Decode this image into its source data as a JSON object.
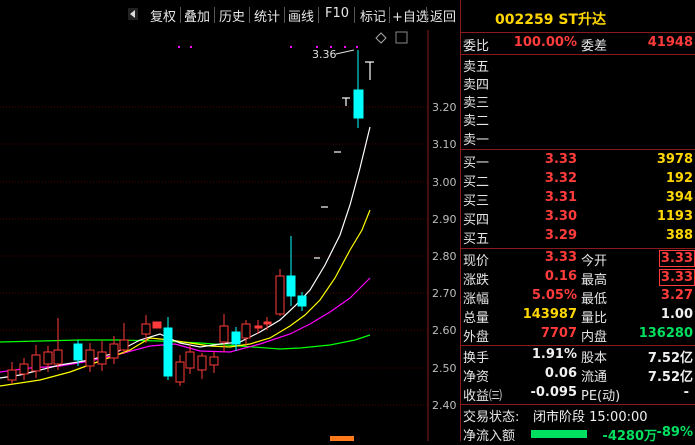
{
  "toolbar": {
    "buttons": [
      "复权",
      "叠加",
      "历史",
      "统计",
      "画线",
      "F10",
      "标记",
      "+自选",
      "返回"
    ]
  },
  "chart": {
    "high_annotation": "3.36",
    "price_ticks": [
      "3.20",
      "3.10",
      "3.00",
      "2.90",
      "2.80",
      "2.70",
      "2.60",
      "2.50",
      "2.40"
    ]
  },
  "quote": {
    "code_name": "002259 ST升达",
    "weibi_label": "委比",
    "weibi_value": "100.00%",
    "weicha_label": "委差",
    "weicha_value": "41948",
    "sell_labels": [
      "卖五",
      "卖四",
      "卖三",
      "卖二",
      "卖一"
    ],
    "buy": [
      {
        "label": "买一",
        "price": "3.33",
        "vol": "3978"
      },
      {
        "label": "买二",
        "price": "3.32",
        "vol": "192"
      },
      {
        "label": "买三",
        "price": "3.31",
        "vol": "394"
      },
      {
        "label": "买四",
        "price": "3.30",
        "vol": "1193"
      },
      {
        "label": "买五",
        "price": "3.29",
        "vol": "388"
      }
    ],
    "xianjia_label": "现价",
    "xianjia": "3.33",
    "jinkai_label": "今开",
    "jinkai": "3.33",
    "zhangdie_label": "涨跌",
    "zhangdie": "0.16",
    "zuigao_label": "最高",
    "zuigao": "3.33",
    "zhangfu_label": "涨幅",
    "zhangfu": "5.05%",
    "zuidi_label": "最低",
    "zuidi": "3.27",
    "zongliang_label": "总量",
    "zongliang": "143987",
    "liangbi_label": "量比",
    "liangbi": "1.00",
    "waipan_label": "外盘",
    "waipan": "7707",
    "neipan_label": "内盘",
    "neipan": "136280",
    "huanshou_label": "换手",
    "huanshou": "1.91%",
    "guben_label": "股本",
    "guben": "7.52亿",
    "jingzi_label": "净资",
    "jingzi": "0.06",
    "liutong_label": "流通",
    "liutong": "7.52亿",
    "shouyi_label": "收益㈢",
    "shouyi": "-0.095",
    "pe_label": "PE(动)",
    "pe": "-",
    "status_label": "交易状态:",
    "status": "闭市阶段 15:00:00",
    "netflow_label": "净流入额",
    "netflow": "-4280万",
    "netflow_pct": "-89%"
  },
  "colors": {
    "up": "#ff3b3b",
    "down": "#00ffff",
    "ma5": "#ffffff",
    "ma10": "#ffff00",
    "ma20": "#ff00ff",
    "ma60": "#00ff00"
  }
}
